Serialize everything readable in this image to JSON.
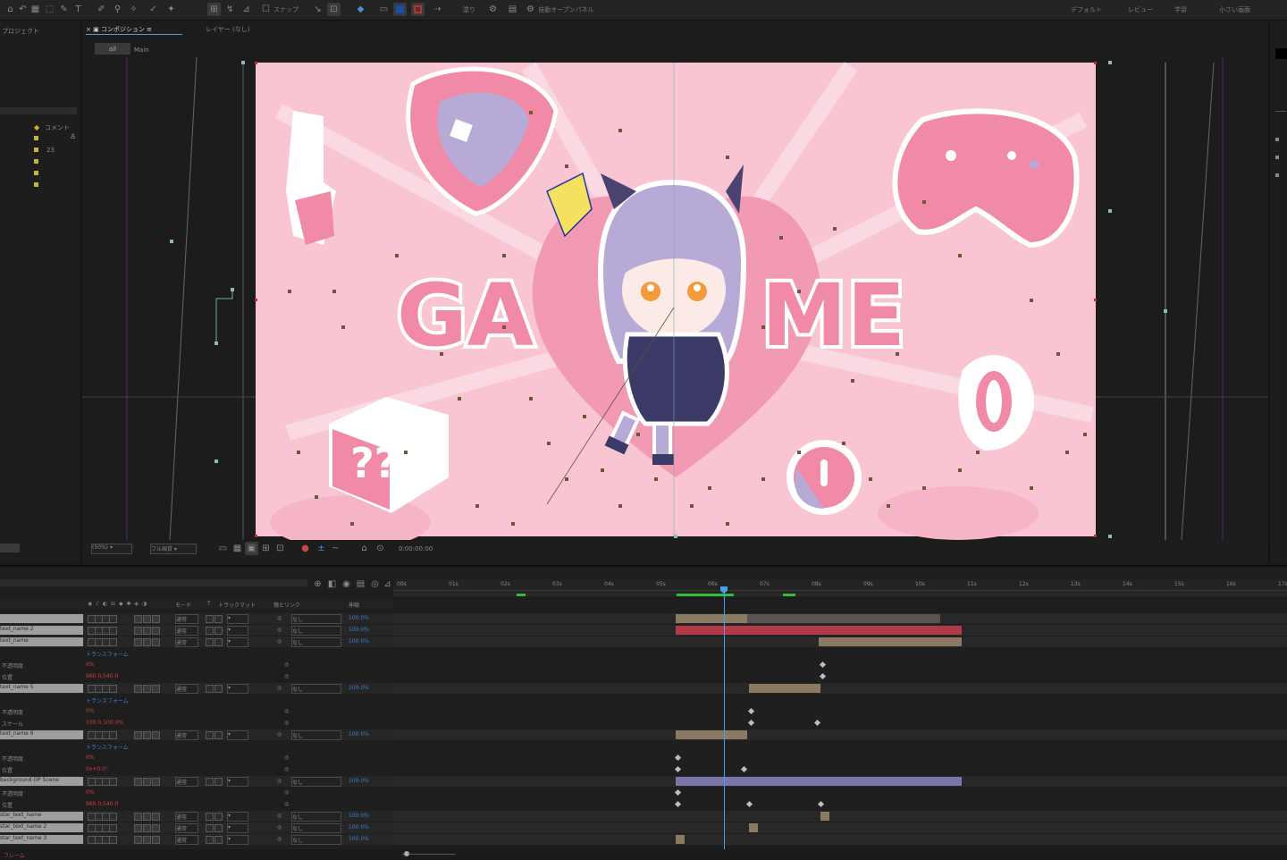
{
  "toolbar": {
    "snap_label": "スナップ",
    "fill_label": "塗り",
    "stroke_label": "線",
    "right_label": "自動オープンパネル",
    "workspaces": [
      "デフォルト",
      "レビュー",
      "学習",
      "小さい画面"
    ]
  },
  "left_panel": {
    "title": "プロジェクト",
    "column_header": "コメント",
    "rows": [
      "",
      "",
      "",
      "",
      ""
    ],
    "row_value": "23"
  },
  "viewer": {
    "tab_active": "コンポジション",
    "tab_other": "レイヤー (なし)",
    "breadcrumb_button": "all",
    "breadcrumb_comp": "Main",
    "zoom_label": "(50%)",
    "quality_label": "フル画質",
    "timecode": "0:00:00:00",
    "canvas_text_ga": "GA",
    "canvas_text_me": "ME",
    "canvas_text_q": "??"
  },
  "timeline": {
    "header_cols": [
      "モード",
      "T",
      "トラックマット",
      "親とリンク",
      "伸縮"
    ],
    "ruler_ticks": [
      "00s",
      "01s",
      "02s",
      "03s",
      "04s",
      "05s",
      "06s",
      "07s",
      "08s",
      "09s",
      "10s",
      "11s",
      "12s",
      "13s",
      "14s",
      "15s",
      "16s",
      "17s"
    ],
    "layers": [
      {
        "name": "",
        "mode": "通常",
        "parent": "なし",
        "stretch": "100.0%"
      },
      {
        "name": "text_name 2",
        "mode": "通常",
        "parent": "なし",
        "stretch": "100.0%"
      },
      {
        "name": "text_name",
        "mode": "通常",
        "parent": "なし",
        "stretch": "100.0%"
      },
      {
        "name": "text_name 5",
        "mode": "通常",
        "parent": "なし",
        "stretch": "100.0%"
      },
      {
        "name": "text_name 6",
        "mode": "通常",
        "parent": "なし",
        "stretch": "100.0%"
      },
      {
        "name": "background OP Scene",
        "mode": "通常",
        "parent": "なし",
        "stretch": "100.0%"
      },
      {
        "name": "star_text_name",
        "mode": "通常",
        "parent": "なし",
        "stretch": "100.0%"
      },
      {
        "name": "star_text_name 2",
        "mode": "通常",
        "parent": "なし",
        "stretch": "100.0%"
      },
      {
        "name": "star_text_name 3",
        "mode": "通常",
        "parent": "なし",
        "stretch": "100.0%"
      }
    ],
    "sub_labels": {
      "transform": "トランスフォーム",
      "opacity": "不透明度",
      "position": "位置",
      "scale": "スケール"
    },
    "sub_values": {
      "opacity": "0%",
      "position": "960.0,540.0",
      "scale": "100.0,100.0%",
      "rotation": "0x+0.0°"
    },
    "footer_label": "フレーム"
  },
  "colors": {
    "canvas_pink": "#f9c5d3",
    "accent_pink": "#f08aa6",
    "playhead_blue": "#4a9fe8",
    "bar_tan": "#8a7a62",
    "bar_red": "#b03a48",
    "bar_lavender": "#7a76a8"
  }
}
